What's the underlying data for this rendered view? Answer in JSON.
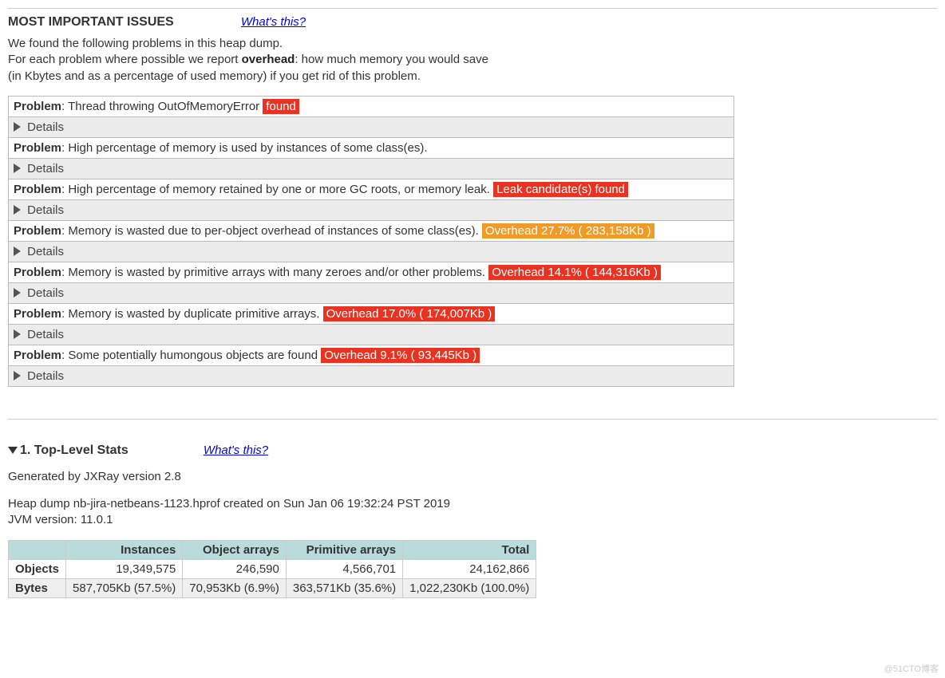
{
  "header": {
    "title": "MOST IMPORTANT ISSUES",
    "whats_this": "What's this?"
  },
  "intro": {
    "line1": "We found the following problems in this heap dump.",
    "line2a": "For each problem where possible we report ",
    "line2b": "overhead",
    "line2c": ": how much memory you would save",
    "line3": "(in Kbytes and as a percentage of used memory) if you get rid of this problem."
  },
  "problems": [
    {
      "label": "Problem",
      "text": ": Thread throwing OutOfMemoryError ",
      "badge": "found",
      "badge_color": "red"
    },
    {
      "label": "Problem",
      "text": ": High percentage of memory is used by instances of some class(es).",
      "badge": "",
      "badge_color": ""
    },
    {
      "label": "Problem",
      "text": ": High percentage of memory retained by one or more GC roots, or memory leak. ",
      "badge": "Leak candidate(s) found",
      "badge_color": "red"
    },
    {
      "label": "Problem",
      "text": ": Memory is wasted due to per-object overhead of instances of some class(es). ",
      "badge": "Overhead 27.7%  ( 283,158Kb )",
      "badge_color": "orange"
    },
    {
      "label": "Problem",
      "text": ": Memory is wasted by primitive arrays with many zeroes and/or other problems. ",
      "badge": "Overhead 14.1%  ( 144,316Kb )",
      "badge_color": "red"
    },
    {
      "label": "Problem",
      "text": ": Memory is wasted by duplicate primitive arrays. ",
      "badge": "Overhead 17.0%  ( 174,007Kb )",
      "badge_color": "red"
    },
    {
      "label": "Problem",
      "text": ": Some potentially humongous objects are found ",
      "badge": "Overhead 9.1%  ( 93,445Kb )",
      "badge_color": "red"
    }
  ],
  "details_label": "Details",
  "section2": {
    "title": "1. Top-Level Stats",
    "whats_this": "What's this?",
    "generated": "Generated by JXRay version 2.8",
    "dump_info": "Heap dump nb-jira-netbeans-1123.hprof created on Sun Jan 06 19:32:24 PST 2019",
    "jvm": "JVM version: 11.0.1"
  },
  "stats": {
    "headers": [
      "",
      "Instances",
      "Object arrays",
      "Primitive arrays",
      "Total"
    ],
    "rows": [
      {
        "label": "Objects",
        "cells": [
          "19,349,575",
          "246,590",
          "4,566,701",
          "24,162,866"
        ]
      },
      {
        "label": "Bytes",
        "cells": [
          "587,705Kb (57.5%)",
          "70,953Kb (6.9%)",
          "363,571Kb (35.6%)",
          "1,022,230Kb (100.0%)"
        ]
      }
    ]
  },
  "watermark": "@51CTO博客"
}
